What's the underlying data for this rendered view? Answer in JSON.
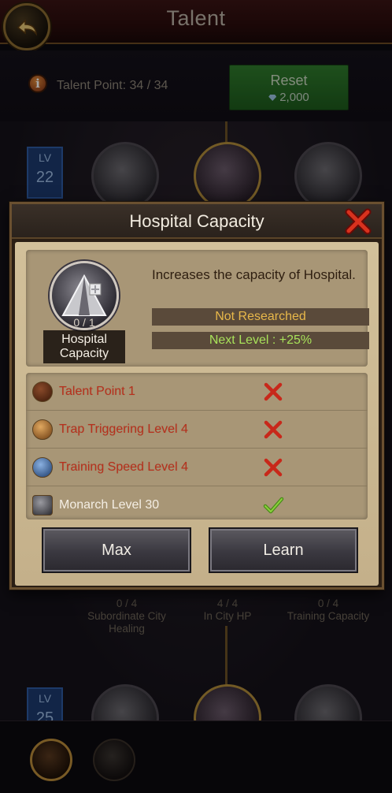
{
  "header": {
    "title": "Talent",
    "back_icon": "back-arrow-icon"
  },
  "talent_points": {
    "label": "Talent Point: 34 / 34"
  },
  "reset_button": {
    "label": "Reset",
    "cost": "2,000",
    "cost_icon": "gem-icon"
  },
  "tree": {
    "tier_top": {
      "lv_label": "LV",
      "lv_value": "22"
    },
    "tier_bottom": {
      "lv_label": "LV",
      "lv_value": "25"
    },
    "nodes_behind": [
      {
        "level": "0 / 4",
        "name": "Subordinate City Healing"
      },
      {
        "level": "4 / 4",
        "name": "In City HP"
      },
      {
        "level": "0 / 4",
        "name": "Training Capacity"
      }
    ]
  },
  "dialog": {
    "title": "Hospital Capacity",
    "skill": {
      "level": "0 / 1",
      "name": "Hospital Capacity",
      "description": "Increases the capacity of Hospital.",
      "status": "Not Researched",
      "next_level": "Next Level : +25%"
    },
    "requirements": [
      {
        "text": "Talent Point 1",
        "icon": "book-icon",
        "met": false,
        "mark_icon": "red-x-icon"
      },
      {
        "text": "Trap Triggering Level 4",
        "icon": "trap-icon",
        "met": false,
        "mark_icon": "red-x-icon"
      },
      {
        "text": "Training Speed Level 4",
        "icon": "soldier-icon",
        "met": false,
        "mark_icon": "red-x-icon"
      },
      {
        "text": "Monarch Level 30",
        "icon": "knight-helmet-icon",
        "met": true,
        "mark_icon": "green-check-icon"
      }
    ],
    "buttons": {
      "max_label": "Max",
      "learn_label": "Learn"
    }
  },
  "colors": {
    "reset_green": "#2f7a2c",
    "requirement_fail": "#b8301c",
    "status_gold": "#e8b84a",
    "next_level_green": "#a8e25a"
  }
}
